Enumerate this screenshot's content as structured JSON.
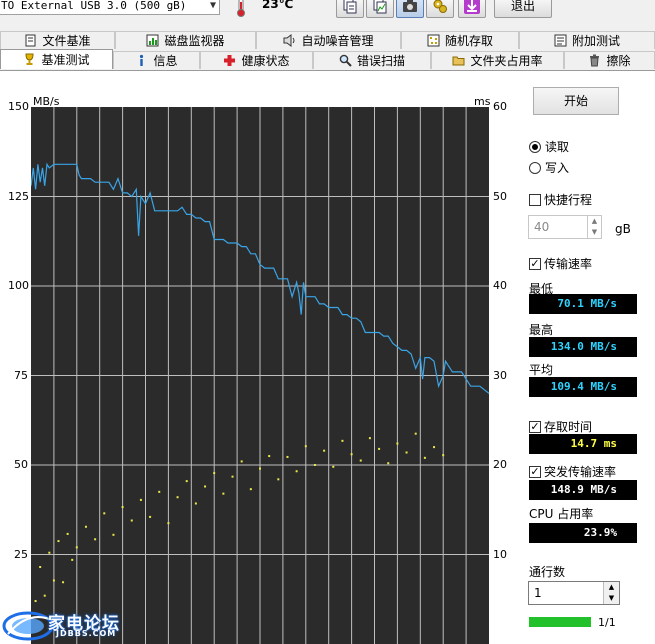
{
  "drive": {
    "name": "TO External USB 3.0 (500 gB)"
  },
  "temperature": {
    "value": "23℃"
  },
  "toolbar": {
    "icons": [
      "copy-info-icon",
      "copy-chart-icon",
      "camera-icon",
      "settings-gear-icon",
      "download-arrow-icon"
    ],
    "exit_label": "退出"
  },
  "tabs": {
    "row1": [
      {
        "label": "文件基准",
        "icon": "file-benchmark-icon"
      },
      {
        "label": "磁盘监视器",
        "icon": "disk-monitor-icon"
      },
      {
        "label": "自动噪音管理",
        "icon": "speaker-icon"
      },
      {
        "label": "随机存取",
        "icon": "random-access-icon"
      },
      {
        "label": "附加测试",
        "icon": "extra-tests-icon"
      }
    ],
    "row2": [
      {
        "label": "基准测试",
        "icon": "benchmark-icon",
        "active": true
      },
      {
        "label": "信息",
        "icon": "info-icon"
      },
      {
        "label": "健康状态",
        "icon": "health-cross-icon"
      },
      {
        "label": "错误扫描",
        "icon": "magnifier-icon"
      },
      {
        "label": "文件夹占用率",
        "icon": "folder-icon"
      },
      {
        "label": "擦除",
        "icon": "trash-icon"
      }
    ]
  },
  "chart_data": {
    "type": "line",
    "left_axis": {
      "unit": "MB/s",
      "ticks": [
        25,
        50,
        75,
        100,
        125,
        150
      ],
      "range": [
        0,
        150
      ]
    },
    "right_axis": {
      "unit": "ms",
      "ticks": [
        10,
        20,
        30,
        40,
        50,
        60
      ],
      "range": [
        0,
        60
      ]
    },
    "x_range": [
      0,
      100
    ],
    "grid": true,
    "colors": {
      "background": "#2b2b2b",
      "grid": "#bfbfbf",
      "transfer_line": "#3aa4e6",
      "access_points": "#e8e84a"
    },
    "series": [
      {
        "unit": "MB/s",
        "color": "#3aa4e6",
        "x": [
          0,
          0.5,
          1,
          1.5,
          2,
          2.5,
          3,
          3.5,
          4,
          5,
          6,
          7,
          8,
          9,
          10,
          10.5,
          11,
          12,
          13,
          14,
          15,
          16,
          17,
          18,
          19,
          20,
          21,
          22,
          23,
          23.5,
          24,
          25,
          26,
          27,
          28,
          29,
          30,
          31,
          32,
          33,
          34,
          35,
          36,
          37,
          38,
          39,
          40,
          41,
          42,
          43,
          44,
          45,
          46,
          47,
          48,
          49,
          50,
          51,
          52,
          53,
          54,
          55,
          56,
          57,
          58,
          58.5,
          59,
          59.5,
          60,
          61,
          62,
          63,
          64,
          65,
          66,
          67,
          68,
          69,
          70,
          71,
          72,
          73,
          74,
          75,
          76,
          77,
          78,
          79,
          80,
          81,
          82,
          83,
          84,
          85,
          85.5,
          86,
          87,
          88,
          89,
          90,
          90.5,
          91,
          92,
          93,
          94,
          95,
          96,
          97,
          98,
          99,
          100
        ],
        "values": [
          128,
          133,
          127,
          134,
          129,
          133,
          128,
          134,
          133,
          134,
          134,
          134,
          134,
          134,
          134,
          131,
          130,
          130,
          130,
          129,
          129,
          129,
          129,
          127,
          130,
          126,
          126,
          125,
          127,
          114,
          125,
          123,
          126,
          121,
          121,
          121,
          121,
          121,
          121,
          122,
          120,
          120,
          119,
          119,
          118,
          118,
          113,
          113,
          113,
          112,
          112,
          112,
          111,
          111,
          109,
          109,
          106,
          105,
          105,
          105,
          102,
          102,
          102,
          97,
          101,
          98,
          92,
          101,
          97,
          97,
          97,
          95,
          95,
          94,
          94,
          94,
          92,
          92,
          91,
          91,
          90,
          87,
          87,
          87,
          87,
          86,
          86,
          84,
          83,
          82,
          82,
          81,
          77,
          80,
          74,
          80,
          80,
          79,
          72,
          75,
          79,
          78,
          76,
          76,
          76,
          74,
          72,
          72,
          72,
          71,
          70
        ]
      },
      {
        "unit": "ms",
        "color": "#e8e84a",
        "x": [
          1,
          2,
          3,
          4,
          5,
          6,
          7,
          8,
          9,
          10,
          12,
          14,
          16,
          18,
          20,
          22,
          24,
          26,
          28,
          30,
          32,
          34,
          36,
          38,
          40,
          42,
          44,
          46,
          48,
          50,
          52,
          54,
          56,
          58,
          60,
          62,
          64,
          66,
          68,
          70,
          72,
          74,
          76,
          78,
          80,
          82,
          84,
          86,
          88,
          90
        ],
        "values": [
          4.8,
          8.6,
          5.4,
          10.2,
          7.1,
          11.5,
          6.9,
          12.3,
          9.4,
          10.8,
          13.1,
          11.7,
          14.6,
          12.2,
          15.3,
          13.8,
          16.1,
          14.2,
          17.0,
          13.5,
          16.4,
          18.2,
          15.7,
          17.6,
          19.1,
          16.8,
          18.7,
          20.4,
          17.3,
          19.6,
          21.0,
          18.4,
          20.9,
          19.3,
          22.1,
          20.0,
          21.6,
          19.8,
          22.7,
          21.2,
          20.5,
          23.0,
          21.8,
          20.2,
          22.4,
          21.4,
          23.5,
          20.8,
          22.0,
          21.1
        ]
      }
    ]
  },
  "panel": {
    "start_label": "开始",
    "read_label": "读取",
    "write_label": "写入",
    "short_stroke_label": "快捷行程",
    "short_stroke_value": "40",
    "short_stroke_unit": "gB",
    "transfer_rate_label": "传输速率",
    "min_label": "最低",
    "min_value": "70.1 MB/s",
    "max_label": "最高",
    "max_value": "134.0 MB/s",
    "avg_label": "平均",
    "avg_value": "109.4 MB/s",
    "access_time_label": "存取时间",
    "access_time_value": "14.7 ms",
    "burst_rate_label": "突发传输速率",
    "burst_rate_value": "148.9 MB/s",
    "cpu_label": "CPU 占用率",
    "cpu_value": "23.9%",
    "passes_label": "通行数",
    "passes_value": "1",
    "progress_label": "1/1",
    "progress_fraction": 1.0
  },
  "watermark": {
    "text": "家电论坛",
    "sub": "JDBBS.COM"
  }
}
